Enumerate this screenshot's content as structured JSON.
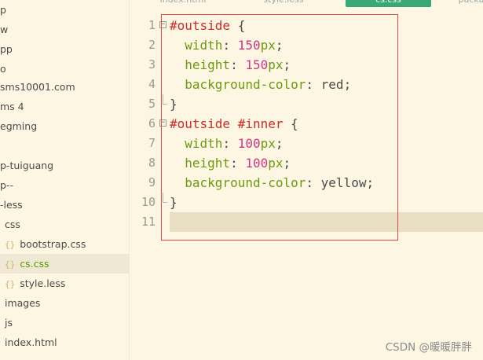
{
  "sidebar": {
    "items": [
      {
        "label": "p"
      },
      {
        "label": "w"
      },
      {
        "label": "pp"
      },
      {
        "label": "o"
      },
      {
        "label": "sms10001.com"
      },
      {
        "label": "ms 4"
      },
      {
        "label": "egming"
      },
      {
        "label": ""
      },
      {
        "label": "p-tuiguang"
      },
      {
        "label": "p--"
      },
      {
        "label": "-less"
      },
      {
        "label": "css"
      },
      {
        "label": "bootstrap.css",
        "icon": "{}"
      },
      {
        "label": "cs.css",
        "icon": "{}"
      },
      {
        "label": "style.less",
        "icon": "{}"
      },
      {
        "label": "images"
      },
      {
        "label": "js"
      },
      {
        "label": "index.html"
      }
    ]
  },
  "tabs": [
    {
      "label": "index.html"
    },
    {
      "label": "style.less"
    },
    {
      "label": "cs.css"
    },
    {
      "label": "packa"
    }
  ],
  "editor": {
    "line_numbers": [
      "1",
      "2",
      "3",
      "4",
      "5",
      "6",
      "7",
      "8",
      "9",
      "10",
      "11"
    ],
    "code": {
      "l1_selector": "#outside",
      "l1_brace": " {",
      "l2_prop": "width",
      "l2_num": "150",
      "l2_unit": "px",
      "l3_prop": "height",
      "l3_num": "150",
      "l3_unit": "px",
      "l4_prop": "background-color",
      "l4_value": "red",
      "l5_brace": "}",
      "l6_selector": "#outside #inner",
      "l6_brace": " {",
      "l7_prop": "width",
      "l7_num": "100",
      "l7_unit": "px",
      "l8_prop": "height",
      "l8_num": "100",
      "l8_unit": "px",
      "l9_prop": "background-color",
      "l9_value": "yellow",
      "l10_brace": "}",
      "colon": ": ",
      "semicolon": ";"
    }
  },
  "watermark": "CSDN @暖暖胖胖",
  "colors": {
    "background": "#fdf6e3",
    "active_tab": "#3aa876",
    "selector": "#cb2c26",
    "property": "#6c9a0e",
    "number": "#d33682",
    "annotation_box": "#e84a4a"
  }
}
